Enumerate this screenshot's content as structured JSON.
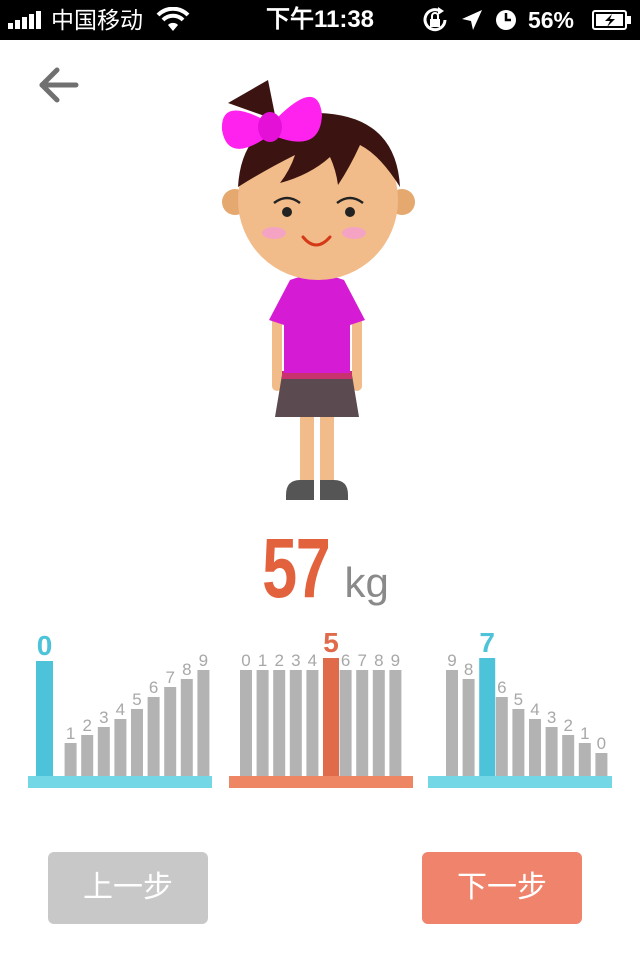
{
  "status_bar": {
    "carrier": "中国移动",
    "time": "下午11:38",
    "battery_percent": "56%"
  },
  "icons": {
    "back": "back-arrow-icon",
    "wifi": "wifi-icon",
    "rotation_lock": "rotation-lock-icon",
    "location": "location-arrow-icon",
    "alarm": "clock-icon",
    "battery": "battery-charging-icon"
  },
  "weight": {
    "value": "57",
    "unit": "kg"
  },
  "pickers": [
    {
      "name": "hundreds",
      "labels": [
        "0",
        "1",
        "2",
        "3",
        "4",
        "5",
        "6",
        "7",
        "8",
        "9"
      ],
      "selected": "0",
      "accent": "#4cc3d9"
    },
    {
      "name": "tens",
      "labels": [
        "0",
        "1",
        "2",
        "3",
        "4",
        "5",
        "6",
        "7",
        "8",
        "9"
      ],
      "selected": "5",
      "accent": "#e06b4b"
    },
    {
      "name": "ones",
      "labels": [
        "9",
        "8",
        "7",
        "6",
        "5",
        "4",
        "3",
        "2",
        "1",
        "0"
      ],
      "selected": "7",
      "accent": "#4cc3d9"
    }
  ],
  "buttons": {
    "prev": "上一步",
    "next": "下一步"
  },
  "colors": {
    "accent_blue": "#4cc3d9",
    "accent_orange": "#e06b4b",
    "bar_gray": "#b3b3b3",
    "label_gray": "#a8a8a8",
    "button_prev": "#c8c8c8",
    "button_next": "#f0836b"
  }
}
